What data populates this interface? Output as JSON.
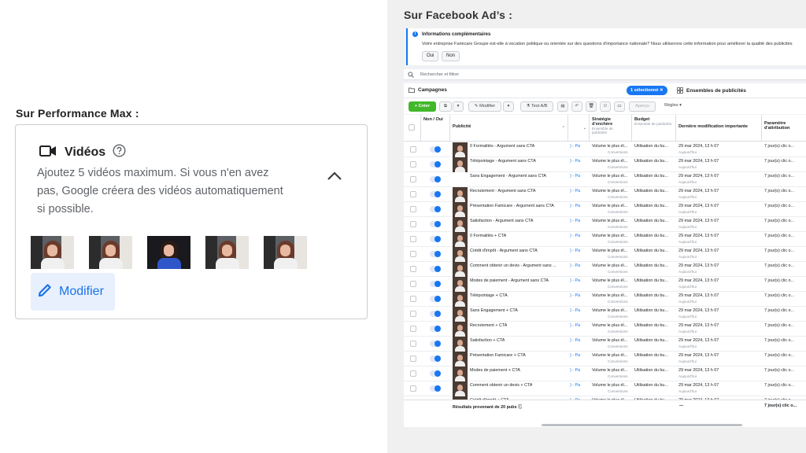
{
  "left": {
    "caption": "Sur Performance Max :",
    "title": "Vidéos",
    "description": "Ajoutez 5 vidéos maximum. Si vous n'en avez pas, Google créera des vidéos automatiquement si possible.",
    "edit_label": "Modifier"
  },
  "right": {
    "caption": "Sur Facebook Ad’s :",
    "info": {
      "title": "Informations complémentaires",
      "text": "Votre entreprise Famicare Groupe est-elle à vocation politique ou orientée sur des questions d'importance nationale? Nous utiliserons cette information pour améliorer la qualité des publicités",
      "yes": "Oui",
      "no": "Non"
    },
    "search_placeholder": "Rechercher et filtrer",
    "tabs": {
      "campaigns": "Campagnes",
      "selected": "1 sélectionné",
      "adsets": "Ensembles de publicités"
    },
    "toolbar": {
      "create": "Créer",
      "edit": "Modifier",
      "ab_test": "Test A/B",
      "preview": "Aperçu",
      "rules": "Règles"
    },
    "columns": {
      "onoff": "Non / Oui",
      "ad": "Publicité",
      "strategy": "Stratégie d'enchère",
      "strategy_sub": "Ensemble de publicités",
      "budget": "Budget",
      "budget_sub": "Ensemble de publicités",
      "last_change": "Dernière modification importante",
      "attribution": "Paramètre d'attribution"
    },
    "row_defaults": {
      "link": ") - Pa",
      "strategy": "Volume le plus él...",
      "strategy_sub": "Conversions",
      "budget": "Utilisation du bu...",
      "date": "29 mar 2024, 13 h 07",
      "date_sub": "Aujourd'hui",
      "attribution": "7 jour(s) clic o..."
    },
    "rows": [
      "0 Formalités - Argument sans CTA",
      "Télépointage - Argument sans CTA",
      "Sans Engagement - Argument sans CTA",
      "Recrutement - Argument sans CTA",
      "Présentation Famicare - Argument sans CTA",
      "Satisfaction - Argument sans CTA",
      "0 Formalités + CTA",
      "Crédit d'impôt - Argument sans CTA",
      "Comment obtenir un devis - Argument sans ...",
      "Modes de paiement - Argument sans CTA",
      "Télépointage + CTA",
      "Sans Engagement + CTA",
      "Recrutement + CTA",
      "Satisfaction + CTA",
      "Présentation Famicare + CTA",
      "Modes de paiement + CTA",
      "Comment obtenir un devis + CTA",
      "Crédit d'impôt + CTA"
    ],
    "footer": {
      "label": "Résultats provenant de 20 pubs",
      "dash": "—",
      "attribution": "7 jour(s) clic o..."
    }
  }
}
